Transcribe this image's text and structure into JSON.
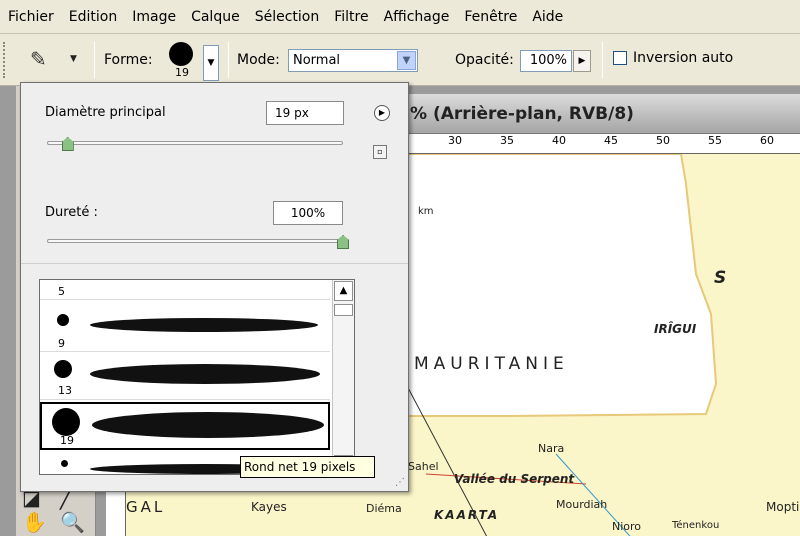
{
  "menu": [
    "Fichier",
    "Edition",
    "Image",
    "Calque",
    "Sélection",
    "Filtre",
    "Affichage",
    "Fenêtre",
    "Aide"
  ],
  "options": {
    "forme_label": "Forme:",
    "brush_size": "19",
    "mode_label": "Mode:",
    "mode_value": "Normal",
    "opacite_label": "Opacité:",
    "opacite_value": "100%",
    "inversion_label": "Inversion auto"
  },
  "document": {
    "title": "% (Arrière-plan, RVB/8)",
    "ruler_labels": [
      "30",
      "35",
      "40",
      "45",
      "50",
      "55",
      "60"
    ],
    "map_labels": [
      "MAURITANIE",
      "IRÎGUI",
      "S",
      "Nara",
      "Vallée du Serpent",
      "Mourdiah",
      "KAARTA",
      "Diéma",
      "Kayes",
      "Sahel",
      "Nioro",
      "Mopti",
      "Ténenkou",
      "GAL",
      "km"
    ]
  },
  "brush_panel": {
    "diameter_label": "Diamètre principal",
    "diameter_value": "19 px",
    "diameter_fraction": 0.07,
    "hardness_label": "Dureté :",
    "hardness_value": "100%",
    "hardness_fraction": 1.0,
    "brushes": [
      {
        "size": "5"
      },
      {
        "size": "9"
      },
      {
        "size": "13"
      },
      {
        "size": "19"
      },
      {
        "size": ""
      }
    ],
    "selected_brush": "19",
    "tooltip": "Rond net 19 pixels"
  },
  "colors": {
    "map_bg": "#fbf6c9",
    "map_white": "#ffffff",
    "slider_thumb": "#89c284"
  }
}
